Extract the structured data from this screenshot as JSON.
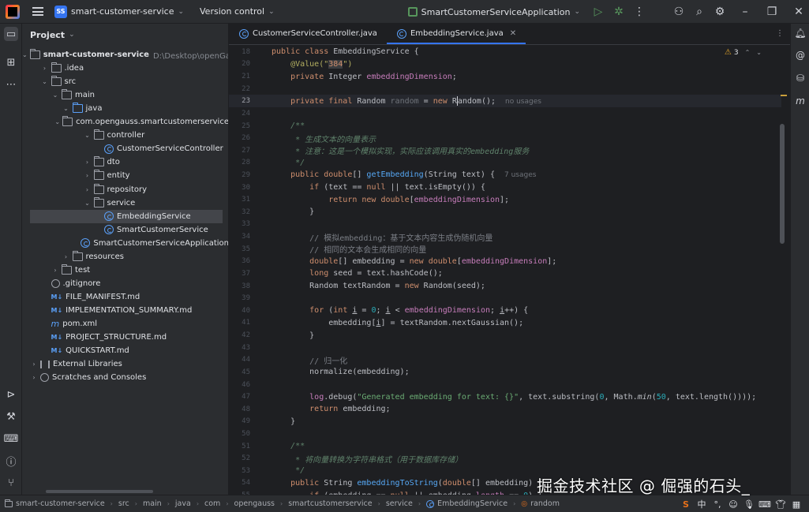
{
  "titlebar": {
    "project_badge": "SS",
    "project_name": "smart-customer-service",
    "vcs": "Version control",
    "run_config": "SmartCustomerServiceApplication"
  },
  "project_panel": {
    "title": "Project",
    "root_path": "D:\\Desktop\\openGauss赋能智",
    "items": [
      {
        "label": "smart-customer-service",
        "depth": 0,
        "arrow": "down",
        "icon": "folder"
      },
      {
        "label": ".idea",
        "depth": 1,
        "arrow": "right",
        "icon": "folder"
      },
      {
        "label": "src",
        "depth": 1,
        "arrow": "down",
        "icon": "folder"
      },
      {
        "label": "main",
        "depth": 2,
        "arrow": "down",
        "icon": "folder"
      },
      {
        "label": "java",
        "depth": 3,
        "arrow": "down",
        "icon": "folder-blue"
      },
      {
        "label": "com.opengauss.smartcustomerservice",
        "depth": 4,
        "arrow": "down",
        "icon": "folder"
      },
      {
        "label": "controller",
        "depth": 5,
        "arrow": "down",
        "icon": "folder"
      },
      {
        "label": "CustomerServiceController",
        "depth": 6,
        "arrow": "",
        "icon": "class"
      },
      {
        "label": "dto",
        "depth": 5,
        "arrow": "right",
        "icon": "folder"
      },
      {
        "label": "entity",
        "depth": 5,
        "arrow": "right",
        "icon": "folder"
      },
      {
        "label": "repository",
        "depth": 5,
        "arrow": "right",
        "icon": "folder"
      },
      {
        "label": "service",
        "depth": 5,
        "arrow": "down",
        "icon": "folder"
      },
      {
        "label": "EmbeddingService",
        "depth": 6,
        "arrow": "",
        "icon": "class",
        "selected": true
      },
      {
        "label": "SmartCustomerService",
        "depth": 6,
        "arrow": "",
        "icon": "class"
      },
      {
        "label": "SmartCustomerServiceApplication",
        "depth": 5,
        "arrow": "",
        "icon": "class"
      },
      {
        "label": "resources",
        "depth": 3,
        "arrow": "right",
        "icon": "folder"
      },
      {
        "label": "test",
        "depth": 2,
        "arrow": "right",
        "icon": "folder"
      },
      {
        "label": ".gitignore",
        "depth": 1,
        "arrow": "",
        "icon": "git"
      },
      {
        "label": "FILE_MANIFEST.md",
        "depth": 1,
        "arrow": "",
        "icon": "md"
      },
      {
        "label": "IMPLEMENTATION_SUMMARY.md",
        "depth": 1,
        "arrow": "",
        "icon": "md"
      },
      {
        "label": "pom.xml",
        "depth": 1,
        "arrow": "",
        "icon": "m"
      },
      {
        "label": "PROJECT_STRUCTURE.md",
        "depth": 1,
        "arrow": "",
        "icon": "md"
      },
      {
        "label": "QUICKSTART.md",
        "depth": 1,
        "arrow": "",
        "icon": "md"
      },
      {
        "label": "External Libraries",
        "depth": 0,
        "arrow": "right",
        "icon": "lib"
      },
      {
        "label": "Scratches and Consoles",
        "depth": 0,
        "arrow": "right",
        "icon": "scratch"
      }
    ]
  },
  "tabs": [
    {
      "label": "CustomerServiceController.java",
      "active": false
    },
    {
      "label": "EmbeddingService.java",
      "active": true
    }
  ],
  "editor": {
    "warnings_count": "3",
    "current_line": 23,
    "lines": [
      {
        "n": "18",
        "tokens": [
          [
            "kw",
            "public class "
          ],
          [
            "ty",
            "EmbeddingService {"
          ]
        ]
      },
      {
        "n": "20",
        "tokens": [
          [
            "ann",
            "    @Value(\""
          ],
          [
            "valbox",
            "384"
          ],
          [
            "ann",
            "\")"
          ]
        ]
      },
      {
        "n": "21",
        "tokens": [
          [
            "kw",
            "    private "
          ],
          [
            "ty",
            "Integer "
          ],
          [
            "fld",
            "embeddingDimension"
          ],
          [
            "ty",
            ";"
          ]
        ]
      },
      {
        "n": "22",
        "tokens": []
      },
      {
        "n": "23",
        "tokens": [
          [
            "kw",
            "    private final "
          ],
          [
            "ty",
            "Random "
          ],
          [
            "unused",
            "random"
          ],
          [
            "ty",
            " = "
          ],
          [
            "kw",
            "new "
          ],
          [
            "ty",
            "R"
          ],
          [
            "caret",
            ""
          ],
          [
            "ty",
            "andom();"
          ],
          [
            "hint",
            "no usages"
          ]
        ]
      },
      {
        "n": "24",
        "tokens": []
      },
      {
        "n": "25",
        "tokens": [
          [
            "doc",
            "    /**"
          ]
        ]
      },
      {
        "n": "26",
        "tokens": [
          [
            "doc",
            "     * 生成文本的向量表示"
          ]
        ]
      },
      {
        "n": "27",
        "tokens": [
          [
            "doc",
            "     * 注意：这是一个模拟实现，实际应该调用真实的embedding服务"
          ]
        ]
      },
      {
        "n": "28",
        "tokens": [
          [
            "doc",
            "     */"
          ]
        ]
      },
      {
        "n": "29",
        "tokens": [
          [
            "kw",
            "    public "
          ],
          [
            "kw",
            "double"
          ],
          [
            "ty",
            "[] "
          ],
          [
            "fn",
            "getEmbedding"
          ],
          [
            "ty",
            "(String text) {"
          ],
          [
            "hint",
            "7 usages"
          ]
        ]
      },
      {
        "n": "30",
        "tokens": [
          [
            "kw",
            "        if "
          ],
          [
            "ty",
            "(text == "
          ],
          [
            "kw",
            "null"
          ],
          [
            "ty",
            " || text.isEmpty()) {"
          ]
        ]
      },
      {
        "n": "31",
        "tokens": [
          [
            "kw",
            "            return new double"
          ],
          [
            "ty",
            "["
          ],
          [
            "fld",
            "embeddingDimension"
          ],
          [
            "ty",
            "];"
          ]
        ]
      },
      {
        "n": "32",
        "tokens": [
          [
            "ty",
            "        }"
          ]
        ]
      },
      {
        "n": "33",
        "tokens": []
      },
      {
        "n": "34",
        "tokens": [
          [
            "cmt",
            "        // 模拟embedding：基于文本内容生成伪随机向量"
          ]
        ]
      },
      {
        "n": "35",
        "tokens": [
          [
            "cmt",
            "        // 相同的文本会生成相同的向量"
          ]
        ]
      },
      {
        "n": "36",
        "tokens": [
          [
            "kw",
            "        double"
          ],
          [
            "ty",
            "[] embedding = "
          ],
          [
            "kw",
            "new double"
          ],
          [
            "ty",
            "["
          ],
          [
            "fld",
            "embeddingDimension"
          ],
          [
            "ty",
            "];"
          ]
        ]
      },
      {
        "n": "37",
        "tokens": [
          [
            "kw",
            "        long "
          ],
          [
            "ty",
            "seed = text.hashCode();"
          ]
        ]
      },
      {
        "n": "38",
        "tokens": [
          [
            "ty",
            "        Random textRandom = "
          ],
          [
            "kw",
            "new "
          ],
          [
            "ty",
            "Random(seed);"
          ]
        ]
      },
      {
        "n": "39",
        "tokens": []
      },
      {
        "n": "40",
        "tokens": [
          [
            "kw",
            "        for "
          ],
          [
            "ty",
            "("
          ],
          [
            "kw",
            "int "
          ],
          [
            "uline",
            "i"
          ],
          [
            "ty",
            " = "
          ],
          [
            "num",
            "0"
          ],
          [
            "ty",
            "; "
          ],
          [
            "uline",
            "i"
          ],
          [
            "ty",
            " < "
          ],
          [
            "fld",
            "embeddingDimension"
          ],
          [
            "ty",
            "; "
          ],
          [
            "uline",
            "i"
          ],
          [
            "ty",
            "++) {"
          ]
        ]
      },
      {
        "n": "41",
        "tokens": [
          [
            "ty",
            "            embedding["
          ],
          [
            "uline",
            "i"
          ],
          [
            "ty",
            "] = textRandom.nextGaussian();"
          ]
        ]
      },
      {
        "n": "42",
        "tokens": [
          [
            "ty",
            "        }"
          ]
        ]
      },
      {
        "n": "43",
        "tokens": []
      },
      {
        "n": "44",
        "tokens": [
          [
            "cmt",
            "        // 归一化"
          ]
        ]
      },
      {
        "n": "45",
        "tokens": [
          [
            "ty",
            "        normalize(embedding);"
          ]
        ]
      },
      {
        "n": "46",
        "tokens": []
      },
      {
        "n": "47",
        "tokens": [
          [
            "fld",
            "        log"
          ],
          [
            "ty",
            ".debug("
          ],
          [
            "str",
            "\"Generated embedding for text: {}\""
          ],
          [
            "ty",
            ", text.substring("
          ],
          [
            "num",
            "0"
          ],
          [
            "ty",
            ", Math."
          ],
          [
            "ital",
            "min"
          ],
          [
            "ty",
            "("
          ],
          [
            "num",
            "50"
          ],
          [
            "ty",
            ", text.length())));"
          ]
        ]
      },
      {
        "n": "48",
        "tokens": [
          [
            "kw",
            "        return "
          ],
          [
            "ty",
            "embedding;"
          ]
        ]
      },
      {
        "n": "49",
        "tokens": [
          [
            "ty",
            "    }"
          ]
        ]
      },
      {
        "n": "50",
        "tokens": []
      },
      {
        "n": "51",
        "tokens": [
          [
            "doc",
            "    /**"
          ]
        ]
      },
      {
        "n": "52",
        "tokens": [
          [
            "doc",
            "     * 将向量转换为字符串格式（用于数据库存储）"
          ]
        ]
      },
      {
        "n": "53",
        "tokens": [
          [
            "doc",
            "     */"
          ]
        ]
      },
      {
        "n": "54",
        "tokens": [
          [
            "kw",
            "    public "
          ],
          [
            "ty",
            "String "
          ],
          [
            "fn",
            "embeddingToString"
          ],
          [
            "ty",
            "("
          ],
          [
            "kw",
            "double"
          ],
          [
            "ty",
            "[] embedding) {"
          ]
        ]
      },
      {
        "n": "55",
        "tokens": [
          [
            "kw",
            "        if "
          ],
          [
            "ty",
            "(embedding == "
          ],
          [
            "kw",
            "null"
          ],
          [
            "ty",
            " || embedding."
          ],
          [
            "fld",
            "length"
          ],
          [
            "ty",
            " == "
          ],
          [
            "num",
            "0"
          ],
          [
            "ty",
            ") {"
          ]
        ]
      }
    ]
  },
  "statusbar": {
    "breadcrumbs": [
      {
        "label": "smart-customer-service",
        "icon": "folder"
      },
      {
        "label": "src",
        "icon": ""
      },
      {
        "label": "main",
        "icon": ""
      },
      {
        "label": "java",
        "icon": ""
      },
      {
        "label": "com",
        "icon": ""
      },
      {
        "label": "opengauss",
        "icon": ""
      },
      {
        "label": "smartcustomerservice",
        "icon": ""
      },
      {
        "label": "service",
        "icon": ""
      },
      {
        "label": "EmbeddingService",
        "icon": "class"
      },
      {
        "label": "random",
        "icon": "field"
      }
    ],
    "ime_lang": "中"
  },
  "watermark": "掘金技术社区 @ 倔强的石头_",
  "colors": {
    "accent": "#3574f0",
    "run_green": "#57965c",
    "warning": "#e0a32b"
  }
}
